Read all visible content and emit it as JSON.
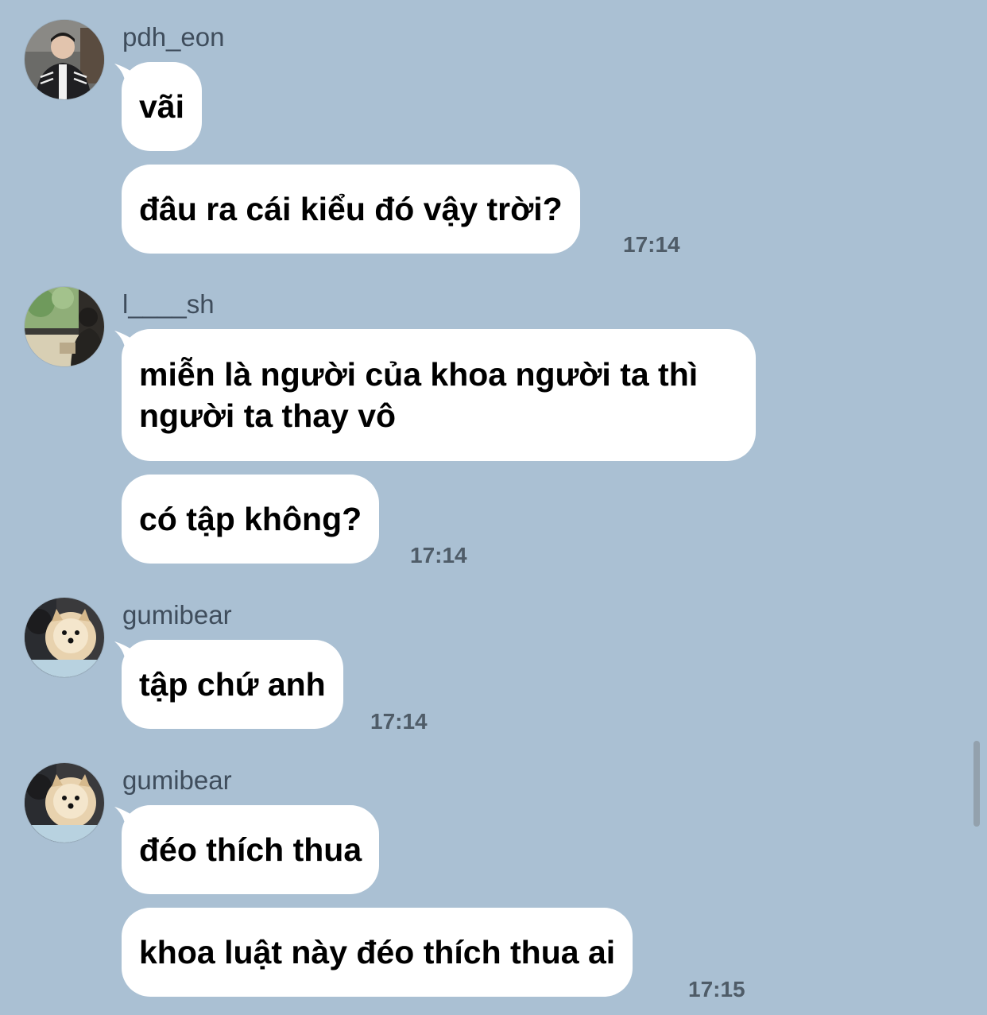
{
  "messages": [
    {
      "sender": "pdh_eon",
      "avatar_icon": "profile-photo-man-in-track-jacket",
      "bubbles": [
        "vãi",
        "đâu ra cái kiểu đó vậy trời?"
      ],
      "time": "17:14"
    },
    {
      "sender": "l____sh",
      "avatar_icon": "profile-photo-person-by-window",
      "bubbles": [
        "miễn là người của khoa người ta thì người ta thay vô",
        "có tập không?"
      ],
      "time": "17:14"
    },
    {
      "sender": "gumibear",
      "avatar_icon": "profile-photo-pomeranian-dog",
      "bubbles": [
        "tập chứ anh"
      ],
      "time": "17:14"
    },
    {
      "sender": "gumibear",
      "avatar_icon": "profile-photo-pomeranian-dog",
      "bubbles": [
        "đéo thích thua",
        "khoa luật này đéo thích thua ai"
      ],
      "time": "17:15"
    }
  ],
  "colors": {
    "background": "#aac0d3",
    "bubble": "#ffffff",
    "sender_text": "#3f4d5c",
    "time_text": "#4f5c68"
  }
}
